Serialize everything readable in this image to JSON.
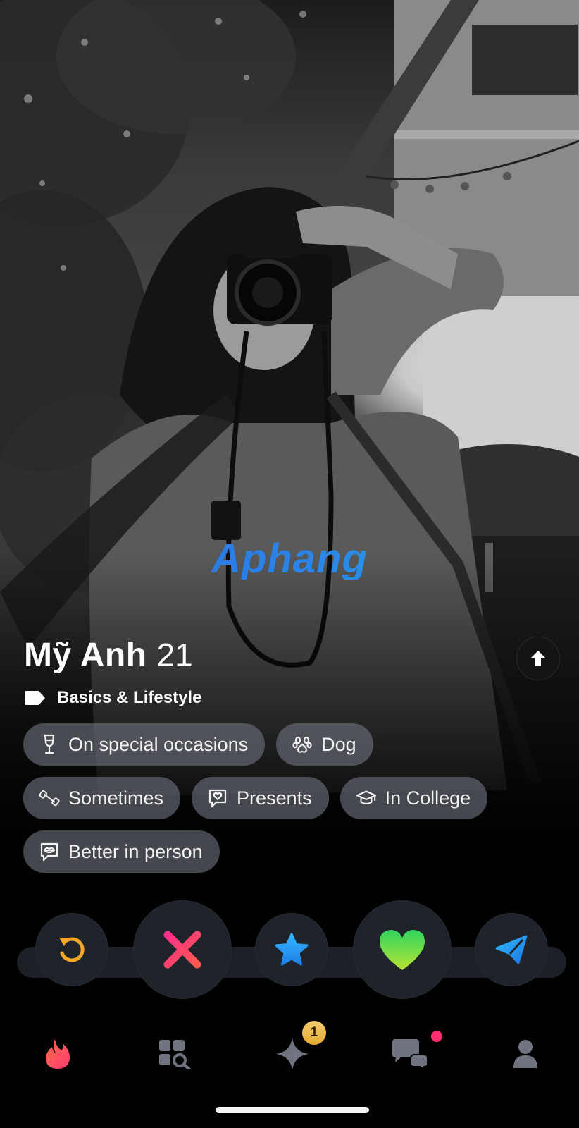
{
  "profile": {
    "name": "Mỹ Anh",
    "age": "21",
    "section_title": "Basics & Lifestyle",
    "chips": [
      {
        "icon": "glass-icon",
        "label": "On special occasions"
      },
      {
        "icon": "paw-icon",
        "label": "Dog"
      },
      {
        "icon": "dumbbell-icon",
        "label": "Sometimes"
      },
      {
        "icon": "gift-bubble-icon",
        "label": "Presents"
      },
      {
        "icon": "graduation-cap-icon",
        "label": "In College"
      },
      {
        "icon": "lips-bubble-icon",
        "label": "Better in person"
      }
    ]
  },
  "watermark": "Aphang",
  "actions": [
    {
      "icon": "rewind-icon",
      "color": "#f5a623"
    },
    {
      "icon": "nope-x-icon",
      "color": "#ff3b74"
    },
    {
      "icon": "super-like-star-icon",
      "color": "#2a9df4"
    },
    {
      "icon": "like-heart-icon",
      "color": "#5fe05a"
    },
    {
      "icon": "boost-send-icon",
      "color": "#2a9df4"
    }
  ],
  "nav": {
    "items": [
      "flame-icon",
      "explore-grid-icon",
      "sparkle-icon",
      "chat-icon",
      "profile-icon"
    ],
    "sparkle_badge": "1",
    "active_color": "#fe3c72"
  }
}
